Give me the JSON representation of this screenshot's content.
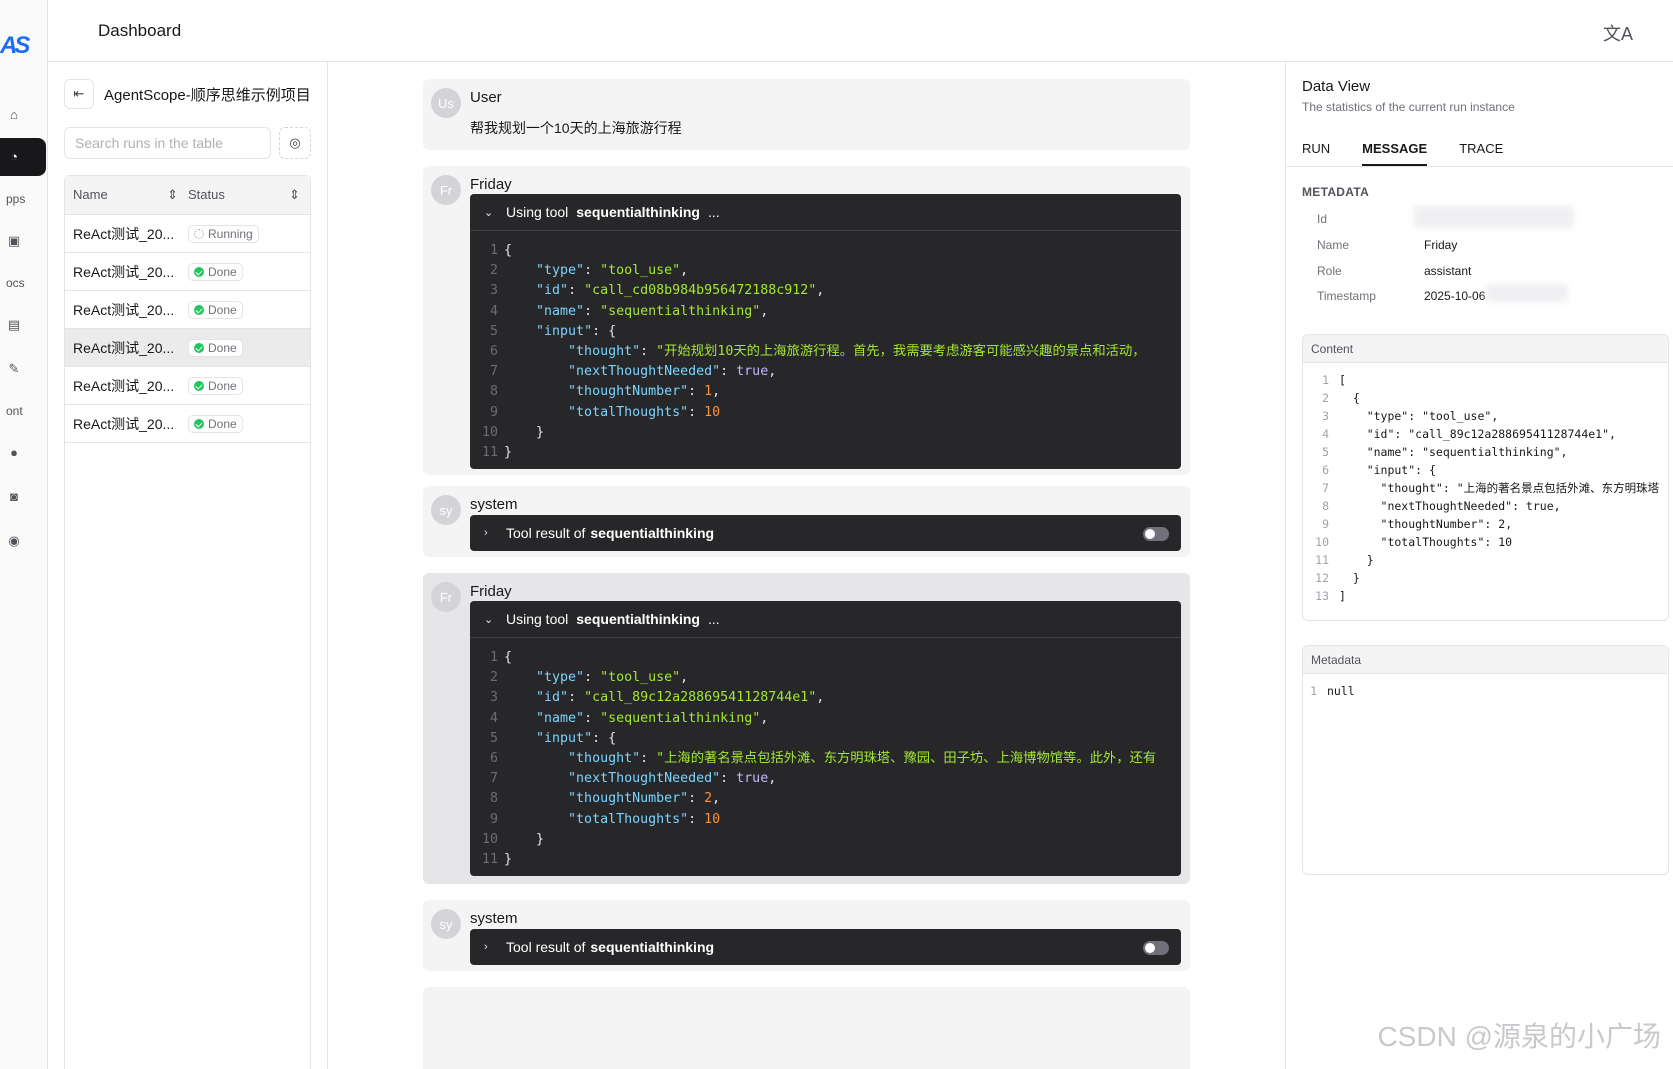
{
  "app": {
    "logo": "AS",
    "title": "Dashboard",
    "lang_icon": "translate-icon"
  },
  "leftnav": [
    {
      "icon": "home-icon",
      "label": ""
    },
    {
      "icon": "dashboard-icon",
      "label": "",
      "active": true
    },
    {
      "icon": "apps-icon",
      "label": "pps"
    },
    {
      "icon": "book-icon",
      "label": ""
    },
    {
      "icon": "docs-icon",
      "label": "ocs"
    },
    {
      "icon": "open-book-icon",
      "label": ""
    },
    {
      "icon": "feather-icon",
      "label": ""
    },
    {
      "icon": "font-icon",
      "label": "ont"
    },
    {
      "icon": "github-icon",
      "label": ""
    },
    {
      "icon": "discord-icon",
      "label": ""
    },
    {
      "icon": "compass-icon",
      "label": ""
    }
  ],
  "runs": {
    "project": "AgentScope-顺序思维示例项目",
    "search_placeholder": "Search runs in the table",
    "columns": {
      "name": "Name",
      "status": "Status"
    },
    "rows": [
      {
        "name": "ReAct测试_20...",
        "status": "Running"
      },
      {
        "name": "ReAct测试_20...",
        "status": "Done"
      },
      {
        "name": "ReAct测试_20...",
        "status": "Done"
      },
      {
        "name": "ReAct测试_20...",
        "status": "Done",
        "selected": true
      },
      {
        "name": "ReAct测试_20...",
        "status": "Done"
      },
      {
        "name": "ReAct测试_20...",
        "status": "Done"
      }
    ]
  },
  "chat": {
    "m1": {
      "avatar": "Us",
      "sender": "User",
      "text": "帮我规划一个10天的上海旅游行程"
    },
    "m2": {
      "avatar": "Fr",
      "sender": "Friday",
      "prefix": "Using tool",
      "tool": "sequentialthinking",
      "ellipsis": "...",
      "code": {
        "id": "call_cd08b984b956472188c912",
        "thought": "开始规划10天的上海旅游行程。首先，我需要考虑游客可能感兴趣的景点和活动，",
        "nextThoughtNeeded": "true",
        "thoughtNumber": "1",
        "totalThoughts": "10"
      }
    },
    "m3": {
      "avatar": "sy",
      "sender": "system",
      "prefix": "Tool result of",
      "tool": "sequentialthinking"
    },
    "m4": {
      "avatar": "Fr",
      "sender": "Friday",
      "prefix": "Using tool",
      "tool": "sequentialthinking",
      "ellipsis": "...",
      "code": {
        "id": "call_89c12a28869541128744e1",
        "thought": "上海的著名景点包括外滩、东方明珠塔、豫园、田子坊、上海博物馆等。此外，还有",
        "nextThoughtNeeded": "true",
        "thoughtNumber": "2",
        "totalThoughts": "10"
      }
    },
    "m5": {
      "avatar": "sy",
      "sender": "system",
      "prefix": "Tool result of",
      "tool": "sequentialthinking"
    }
  },
  "dataview": {
    "title": "Data View",
    "subtitle": "The statistics of the current run instance",
    "tabs": [
      "RUN",
      "MESSAGE",
      "TRACE"
    ],
    "metadata_header": "METADATA",
    "meta": [
      {
        "k": "Id",
        "v": ""
      },
      {
        "k": "Name",
        "v": "Friday"
      },
      {
        "k": "Role",
        "v": "assistant"
      },
      {
        "k": "Timestamp",
        "v": "2025-10-06"
      }
    ],
    "content_header": "Content",
    "content": {
      "id": "call_89c12a28869541128744e1",
      "thought": "上海的著名景点包括外滩、东方明珠塔",
      "thoughtNumber": "2",
      "totalThoughts": "10"
    },
    "metadata_box_header": "Metadata",
    "metadata_value": "null"
  },
  "watermark": "CSDN @源泉的小广场"
}
